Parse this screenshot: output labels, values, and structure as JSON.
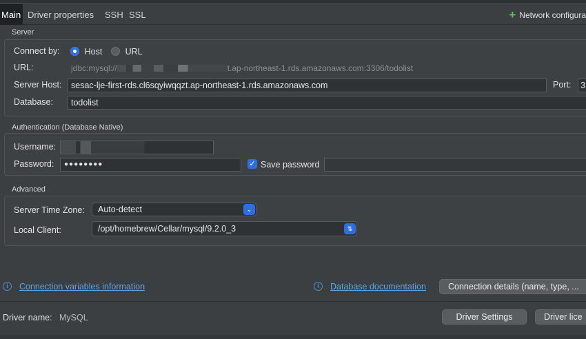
{
  "tabs": [
    {
      "label": "Main",
      "active": true
    },
    {
      "label": "Driver properties"
    },
    {
      "label": "SSH"
    },
    {
      "label": "SSL"
    }
  ],
  "network_config": "Network configura",
  "server": {
    "title": "Server",
    "connect_by_label": "Connect by:",
    "host_option": "Host",
    "url_option": "URL",
    "selected": "Host",
    "url_label": "URL:",
    "url_prefix": "jdbc:mysql://",
    "url_suffix": "t.ap-northeast-1.rds.amazonaws.com:3306/todolist",
    "host_label": "Server Host:",
    "host_value": "sesac-lje-first-rds.cl6sqyiwqqzt.ap-northeast-1.rds.amazonaws.com",
    "port_label": "Port:",
    "port_value": "3",
    "database_label": "Database:",
    "database_value": "todolist"
  },
  "auth": {
    "title": "Authentication (Database Native)",
    "username_label": "Username:",
    "password_label": "Password:",
    "password_value": "●●●●●●●●",
    "save_password_label": "Save password",
    "save_password_checked": true,
    "check_mark": "✓"
  },
  "advanced": {
    "title": "Advanced",
    "timezone_label": "Server Time Zone:",
    "timezone_value": "Auto-detect",
    "timezone_arrow": "⌄",
    "client_label": "Local Client:",
    "client_value": "/opt/homebrew/Cellar/mysql/9.2.0_3",
    "client_arrow": "⇅"
  },
  "links": {
    "info_glyph": "i",
    "conn_vars": "Connection variables information",
    "db_docs": "Database documentation",
    "conn_details_button": "Connection details (name, type, ..."
  },
  "driver": {
    "label": "Driver name:",
    "value": "MySQL",
    "settings_button": "Driver Settings",
    "license_button": "Driver lice"
  },
  "colors": {
    "background": "#3b3f42",
    "accent": "#2e6ee0",
    "link": "#5aa7e8",
    "plus_green": "#5ec05e"
  }
}
